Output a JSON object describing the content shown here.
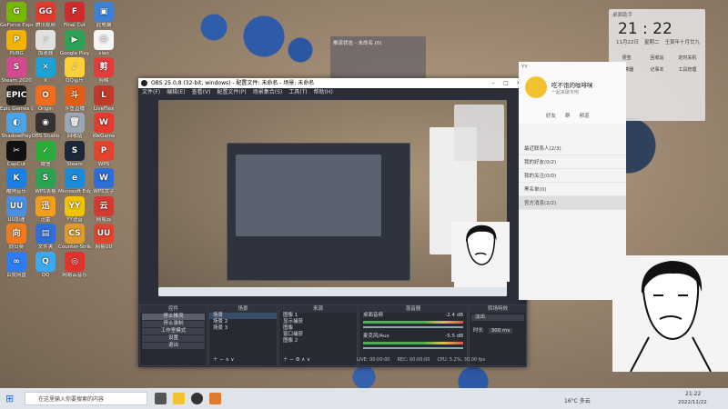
{
  "desktop_icons": [
    {
      "label": "GeForce Experience",
      "color": "#76b900",
      "glyph": "G"
    },
    {
      "label": "腾讯视频",
      "color": "#e23b2e",
      "glyph": "GG"
    },
    {
      "label": "Final Cut",
      "color": "#d02a2a",
      "glyph": "F"
    },
    {
      "label": "此电脑",
      "color": "#3b82d6",
      "glyph": "▣"
    },
    {
      "label": "PUBG",
      "color": "#f0b400",
      "glyph": "P"
    },
    {
      "label": "加速器",
      "color": "#e0e0e0",
      "glyph": "⚡"
    },
    {
      "label": "Google Play",
      "color": "#2aa356",
      "glyph": "▶"
    },
    {
      "label": "xiao",
      "color": "#f5f5f5",
      "glyph": "☺"
    },
    {
      "label": "Steam 2020",
      "color": "#d34a8e",
      "glyph": "S"
    },
    {
      "label": "X",
      "color": "#1da2d8",
      "glyph": "✕"
    },
    {
      "label": "QQ音乐",
      "color": "#fbd13a",
      "glyph": "♪"
    },
    {
      "label": "剪映",
      "color": "#e63b3b",
      "glyph": "剪"
    },
    {
      "label": "Epic Games Launcher",
      "color": "#222",
      "glyph": "EPIC"
    },
    {
      "label": "Origin",
      "color": "#f36b1c",
      "glyph": "O"
    },
    {
      "label": "斗鱼直播",
      "color": "#e45d12",
      "glyph": "斗"
    },
    {
      "label": "LiveFlex",
      "color": "#c0392b",
      "glyph": "L"
    },
    {
      "label": "ShadowPlay",
      "color": "#4ba4e6",
      "glyph": "◐"
    },
    {
      "label": "OBS Studio",
      "color": "#333",
      "glyph": "◉"
    },
    {
      "label": "回收站",
      "color": "#9aa7b5",
      "glyph": "🗑"
    },
    {
      "label": "WeGame",
      "color": "#e33b2f",
      "glyph": "W"
    },
    {
      "label": "CapCut",
      "color": "#111",
      "glyph": "✂"
    },
    {
      "label": "微信",
      "color": "#2bae39",
      "glyph": "✓"
    },
    {
      "label": "Steam",
      "color": "#1b2838",
      "glyph": "S"
    },
    {
      "label": "WPS",
      "color": "#e0442f",
      "glyph": "P"
    },
    {
      "label": "酷狗音乐",
      "color": "#1c7fe3",
      "glyph": "K"
    },
    {
      "label": "WPS表格",
      "color": "#2aa350",
      "glyph": "S"
    },
    {
      "label": "Microsoft Edge",
      "color": "#1b8bd8",
      "glyph": "e"
    },
    {
      "label": "WPS文字",
      "color": "#2b6ed8",
      "glyph": "W"
    },
    {
      "label": "UU加速",
      "color": "#4a90e2",
      "glyph": "UU"
    },
    {
      "label": "迅雷",
      "color": "#f2a01b",
      "glyph": "迅"
    },
    {
      "label": "YY语音",
      "color": "#f0c400",
      "glyph": "YY"
    },
    {
      "label": "网易云",
      "color": "#d33a31",
      "glyph": "云"
    },
    {
      "label": "向日葵",
      "color": "#f07b1d",
      "glyph": "向"
    },
    {
      "label": "文件夹",
      "color": "#2f6fd6",
      "glyph": "▤"
    },
    {
      "label": "Counter-Strike Global",
      "color": "#e09a2c",
      "glyph": "CS"
    },
    {
      "label": "网易UU",
      "color": "#e0442f",
      "glyph": "UU"
    },
    {
      "label": "百度网盘",
      "color": "#2f7bf0",
      "glyph": "∞"
    },
    {
      "label": "QQ",
      "color": "#3ba8f0",
      "glyph": "Q"
    },
    {
      "label": "网易云音乐",
      "color": "#e0332e",
      "glyph": "◎"
    }
  ],
  "obs": {
    "title": "OBS 25.0.8 (32-bit, windows) - 配置文件: 未命名 - 场景: 未命名",
    "menu": [
      "文件(F)",
      "编辑(E)",
      "查看(V)",
      "配置文件(P)",
      "场景集合(S)",
      "工具(T)",
      "帮助(H)"
    ],
    "scenes_header": "场景",
    "scenes": [
      "场景",
      "场景 2",
      "场景 3"
    ],
    "sources_header": "来源",
    "sources": [
      "图像 1",
      "显示捕获",
      "图像",
      "窗口捕获",
      "图像 2"
    ],
    "mixer_header": "混音器",
    "mixer": [
      {
        "name": "桌面音频",
        "db": "-2.4 dB"
      },
      {
        "name": "麦克风/Aux",
        "db": "-5.5 dB"
      }
    ],
    "transitions_header": "转场特效",
    "transition": "淡出",
    "duration_label": "时长",
    "duration": "300 ms",
    "controls_header": "控件",
    "controls": [
      "停止推流",
      "停止录制",
      "工作室模式",
      "设置",
      "退出"
    ],
    "status": {
      "live": "LIVE: 00:00:00",
      "rec": "REC: 00:00:00",
      "cpu": "CPU: 5.2%, 30.00 fps"
    }
  },
  "clock": {
    "header": "桌面助手",
    "time": "21 : 22",
    "date": "11月22日",
    "weekday": "星期二",
    "lunar": "壬寅年十月廿九",
    "items": [
      "便签",
      "回收站",
      "定时关机",
      "计算器",
      "记事本",
      "工具管理"
    ]
  },
  "chat": {
    "title": "YY",
    "name": "吃不饱的咖啡咪",
    "subtitle": "一起来聊天吧",
    "tabs": [
      "好友",
      "群",
      "频道"
    ],
    "rows": [
      "最近联系人(2/3)",
      "我的好友(0/2)",
      "我的关注(0/0)",
      "黑名单(0)",
      "官方消息(2/2)"
    ]
  },
  "small_window": {
    "title": "推流状态 - 未命名 (0)"
  },
  "taskbar": {
    "search_placeholder": "在这里输入你要搜索的内容",
    "weather": "16°C 多云",
    "time": "21:22",
    "date": "2022/11/22"
  }
}
